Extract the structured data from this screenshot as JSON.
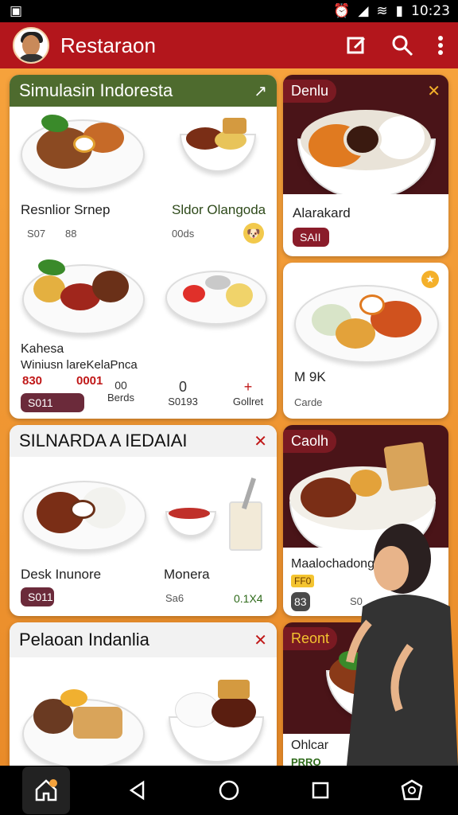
{
  "status": {
    "time": "10:23"
  },
  "appbar": {
    "title": "Restaraon"
  },
  "cards": {
    "c1": {
      "title": "Simulasin Indoresta",
      "items": [
        {
          "name": "Resnlior Srnep",
          "meta1": "S07",
          "meta2": "88"
        },
        {
          "name": "Sldor Olangoda",
          "meta1": "00ds"
        }
      ],
      "row2": {
        "label1": "Kahesa",
        "label2": "Winiusn lareKelaPnca",
        "price1": "830",
        "price2": "0001",
        "pill": "S011",
        "actions": [
          {
            "icon": "00",
            "label": "Berds"
          },
          {
            "icon": "0",
            "label": "S0193"
          },
          {
            "icon": "+",
            "label": "Gollret"
          }
        ]
      }
    },
    "c2": {
      "tag": "Denlu",
      "name": "Alarakard",
      "pill": "SAII"
    },
    "c3": {
      "name": "M 9K",
      "sub": "Carde"
    },
    "c4": {
      "title": "SILNARDA A IEDAIAI",
      "items": [
        {
          "name": "Desk Inunore",
          "pill": "S011"
        },
        {
          "name": "Monera",
          "sub": "Sa6",
          "price": "0.1X4"
        }
      ]
    },
    "c5": {
      "tag": "Caolh",
      "name": "Maalochadonger",
      "badge": "FF0",
      "pill": "83",
      "sub": "S0"
    },
    "c6": {
      "title": "Pelaoan Indanlia"
    },
    "c7": {
      "tag": "Reont",
      "name": "Ohlcar",
      "sub": "PRRO"
    }
  },
  "colors": {
    "appbar": "#b3161c",
    "accent": "#f4a23c",
    "tag": "#7a1a22",
    "header_green": "#4e6b2e"
  }
}
